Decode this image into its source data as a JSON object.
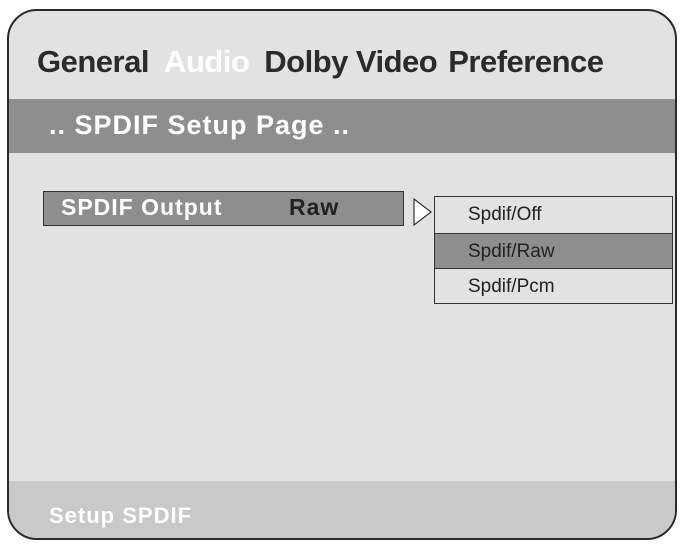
{
  "tabs": [
    {
      "label": "General",
      "active": false
    },
    {
      "label": "Audio",
      "active": true
    },
    {
      "label": "Dolby",
      "active": false
    },
    {
      "label": "Video",
      "active": false
    },
    {
      "label": "Preference",
      "active": false
    }
  ],
  "page": {
    "title": ".. SPDIF Setup Page .."
  },
  "setting": {
    "label": "SPDIF Output",
    "value": "Raw",
    "arrow_icon": "triangle-right-icon"
  },
  "dropdown": {
    "options": [
      "Spdif/Off",
      "Spdif/Raw",
      "Spdif/Pcm"
    ],
    "selected": "Spdif/Raw"
  },
  "status": {
    "text": "Setup SPDIF"
  },
  "colors": {
    "panel": "#e2e2e2",
    "highlight": "#8e8e8e",
    "text_light": "#ffffff",
    "text_dark": "#2b2b2b"
  }
}
